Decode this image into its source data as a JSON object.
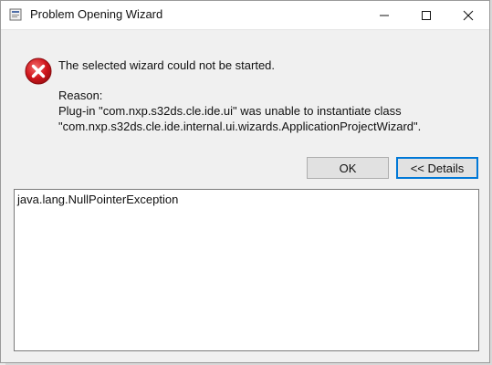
{
  "window": {
    "title": "Problem Opening Wizard",
    "icons": {
      "app": "wizard-app-icon",
      "minimize": "minimize-icon",
      "maximize": "maximize-icon",
      "close": "close-icon",
      "error": "error-icon"
    }
  },
  "message": {
    "main": "The selected wizard could not be started.",
    "reason_label": "Reason:",
    "reason_line1": "Plug-in \"com.nxp.s32ds.cle.ide.ui\" was unable to instantiate class",
    "reason_line2": "\"com.nxp.s32ds.cle.ide.internal.ui.wizards.ApplicationProjectWizard\"."
  },
  "buttons": {
    "ok": "OK",
    "details": "<< Details"
  },
  "details": {
    "text": "java.lang.NullPointerException"
  },
  "colors": {
    "error_red": "#d0161c",
    "focus_blue": "#0078d7",
    "button_face": "#e1e1e1"
  }
}
